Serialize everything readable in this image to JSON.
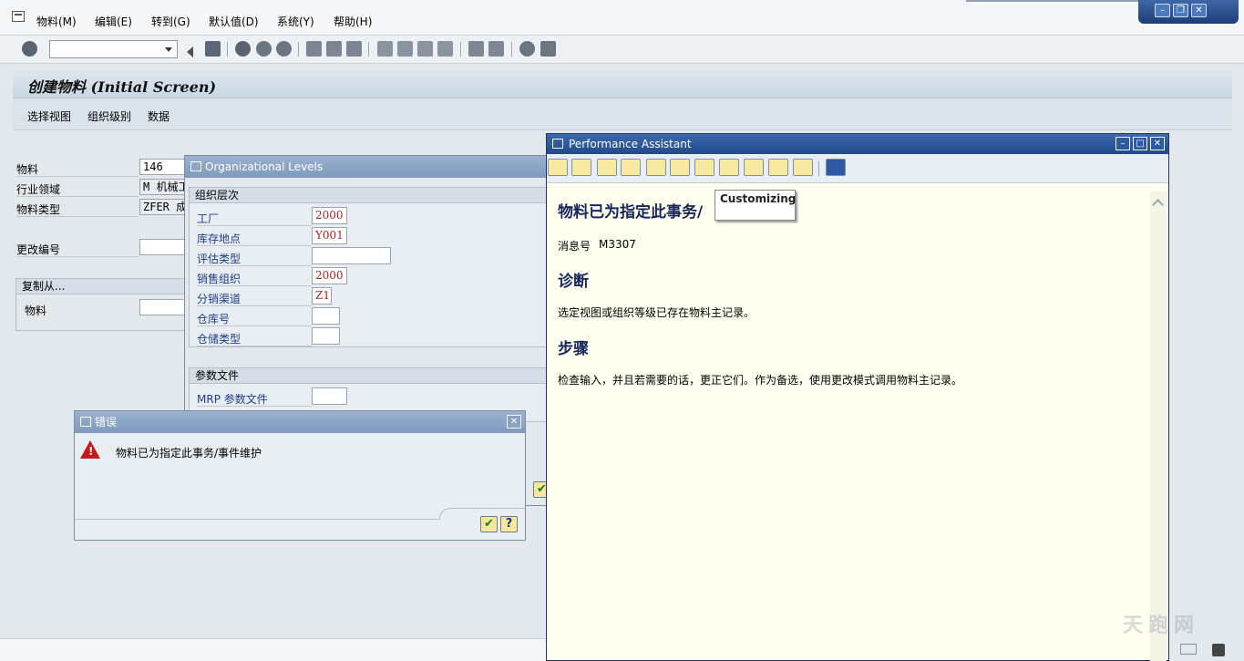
{
  "menubar": {
    "items": [
      "物料(M)",
      "编辑(E)",
      "转到(G)",
      "默认值(D)",
      "系统(Y)",
      "帮助(H)"
    ]
  },
  "window_controls": {
    "minimize": "–",
    "restore": "❐",
    "close": "✕"
  },
  "toolbar": {
    "command_field_value": ""
  },
  "page": {
    "title": "创建物料 (Initial Screen)",
    "app_buttons": [
      "选择视图",
      "组织级别",
      "数据"
    ]
  },
  "form": {
    "material_label": "物料",
    "material_value": "146",
    "industry_label": "行业领域",
    "industry_value": "M 机械工",
    "mattype_label": "物料类型",
    "mattype_value": "ZFER 成品",
    "change_no_label": "更改编号",
    "change_no_value": "",
    "copy_from_title": "复制从...",
    "copy_material_label": "物料",
    "copy_material_value": ""
  },
  "org_levels": {
    "title": "Organizational Levels",
    "group1_title": "组织层次",
    "fields": [
      {
        "label": "工厂",
        "value": "2000"
      },
      {
        "label": "库存地点",
        "value": "Y001"
      },
      {
        "label": "评估类型",
        "value": ""
      },
      {
        "label": "销售组织",
        "value": "2000"
      },
      {
        "label": "分销渠道",
        "value": "Z1"
      },
      {
        "label": "仓库号",
        "value": ""
      },
      {
        "label": "仓储类型",
        "value": ""
      }
    ],
    "group2_title": "参数文件",
    "mrp_label": "MRP 参数文件",
    "mrp_value": ""
  },
  "error_dialog": {
    "title": "错误",
    "message": "物料已为指定此事务/事件维护"
  },
  "performance_assistant": {
    "title": "Performance Assistant",
    "heading": "物料已为指定此事务/",
    "tooltip": "Customizing",
    "msg_no_label": "消息号",
    "msg_no_value": "M3307",
    "diag_heading": "诊断",
    "diag_text": "选定视图或组织等级已存在物料主记录。",
    "steps_heading": "步骤",
    "steps_text": "检查输入，并且若需要的话，更正它们。作为备选，使用更改模式调用物料主记录。"
  },
  "watermark": "天跑网",
  "colors": {
    "error_icon": "#c8161d",
    "pa_header": "#22488a",
    "pa_background": "#ffffef",
    "dialog_header": "#8aa3c4"
  }
}
